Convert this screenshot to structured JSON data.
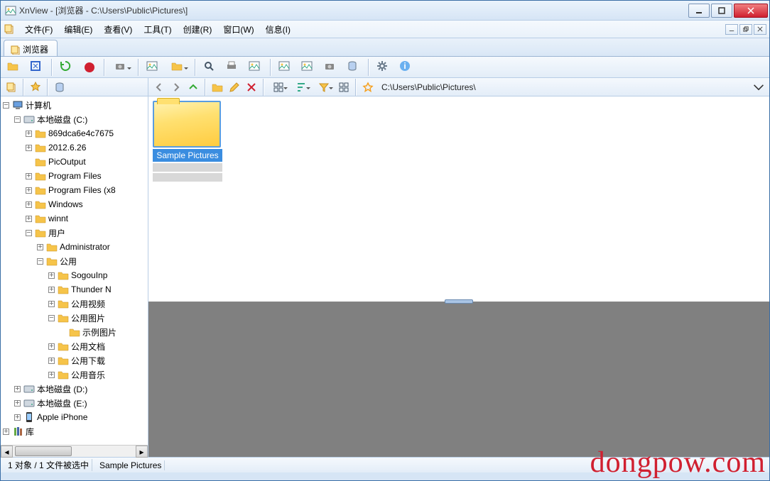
{
  "window": {
    "title": "XnView - [浏览器 - C:\\Users\\Public\\Pictures\\]"
  },
  "menu": {
    "file": "文件(F)",
    "edit": "编辑(E)",
    "view": "查看(V)",
    "tools": "工具(T)",
    "create": "创建(R)",
    "window": "窗口(W)",
    "info": "信息(I)"
  },
  "tabs": {
    "browser": "浏览器"
  },
  "address": {
    "path": "C:\\Users\\Public\\Pictures\\"
  },
  "tree": {
    "root": "计算机",
    "c": "本地磁盘 (C:)",
    "c1": "869dca6e4c7675",
    "c2": "2012.6.26",
    "c3": "PicOutput",
    "c4": "Program Files",
    "c5": "Program Files (x8",
    "c6": "Windows",
    "c7": "winnt",
    "c8": "用户",
    "c8a": "Administrator",
    "c8b": "公用",
    "c8b1": "SogouInp",
    "c8b2": "Thunder N",
    "c8b3": "公用视频",
    "c8b4": "公用图片",
    "c8b4a": "示例图片",
    "c8b5": "公用文档",
    "c8b6": "公用下载",
    "c8b7": "公用音乐",
    "d": "本地磁盘 (D:)",
    "e": "本地磁盘 (E:)",
    "iphone": "Apple iPhone",
    "lib": "库"
  },
  "thumb": {
    "name": "Sample Pictures"
  },
  "status": {
    "objects": "1 对象 / 1 文件被选中",
    "sel": "Sample Pictures"
  },
  "watermark": "dongpow.com"
}
